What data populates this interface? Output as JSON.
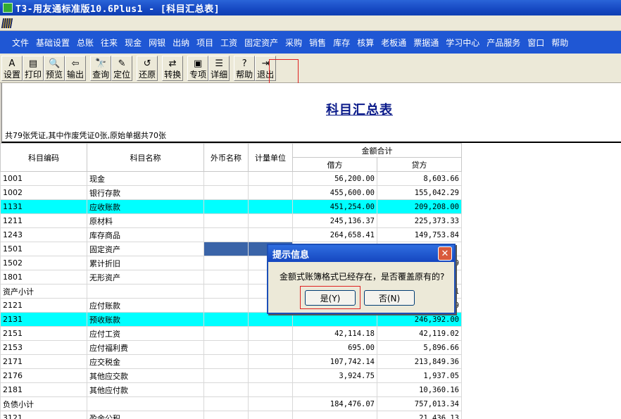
{
  "window": {
    "title": "T3-用友通标准版10.6Plus1 - [科目汇总表]"
  },
  "menu": [
    "文件",
    "基础设置",
    "总账",
    "往来",
    "现金",
    "网银",
    "出纳",
    "项目",
    "工资",
    "固定资产",
    "采购",
    "销售",
    "库存",
    "核算",
    "老板通",
    "票据通",
    "学习中心",
    "产品服务",
    "窗口",
    "帮助"
  ],
  "toolbar": {
    "groups": [
      [
        {
          "label": "设置",
          "icon": "settings-icon",
          "glyph": "A"
        },
        {
          "label": "打印",
          "icon": "print-icon",
          "glyph": "▤"
        },
        {
          "label": "预览",
          "icon": "preview-icon",
          "glyph": "🔍"
        },
        {
          "label": "输出",
          "icon": "export-icon",
          "glyph": "⇦"
        }
      ],
      [
        {
          "label": "查询",
          "icon": "query-icon",
          "glyph": "🔭"
        },
        {
          "label": "定位",
          "icon": "locate-icon",
          "glyph": "✎"
        }
      ],
      [
        {
          "label": "还原",
          "icon": "restore-icon",
          "glyph": "↺"
        }
      ],
      [
        {
          "label": "转换",
          "icon": "convert-icon",
          "glyph": "⇄"
        }
      ],
      [
        {
          "label": "专项",
          "icon": "special-icon",
          "glyph": "▣"
        },
        {
          "label": "详细",
          "icon": "detail-icon",
          "glyph": "☰"
        }
      ],
      [
        {
          "label": "帮助",
          "icon": "help-icon",
          "glyph": "?"
        },
        {
          "label": "退出",
          "icon": "exit-icon",
          "glyph": "⇥"
        }
      ]
    ]
  },
  "report": {
    "title": "科目汇总表",
    "info": "共79张凭证,其中作废凭证0张,原始单据共70张"
  },
  "table": {
    "headers": {
      "code": "科目编码",
      "name": "科目名称",
      "fc": "外币名称",
      "unit": "计量单位",
      "total": "金额合计",
      "debit": "借方",
      "credit": "贷方"
    },
    "rows": [
      {
        "code": "1001",
        "name": "现金",
        "debit": "56,200.00",
        "credit": "8,603.66",
        "hl": false
      },
      {
        "code": "1002",
        "name": "银行存款",
        "debit": "455,600.00",
        "credit": "155,042.29",
        "hl": false
      },
      {
        "code": "1131",
        "name": "应收账款",
        "debit": "451,254.00",
        "credit": "209,208.00",
        "hl": true
      },
      {
        "code": "1211",
        "name": "原材料",
        "debit": "245,136.37",
        "credit": "225,373.33",
        "hl": false
      },
      {
        "code": "1243",
        "name": "库存商品",
        "debit": "264,658.41",
        "credit": "149,753.84",
        "hl": false
      },
      {
        "code": "1501",
        "name": "固定资产",
        "debit": "",
        "credit": "",
        "hl": false,
        "sel": true
      },
      {
        "code": "1502",
        "name": "累计折旧",
        "debit": "",
        "credit": "9",
        "hl": false
      },
      {
        "code": "1801",
        "name": "无形资产",
        "debit": "",
        "credit": "",
        "hl": false
      },
      {
        "code": "资产小计",
        "name": "",
        "debit": "",
        "credit": "1",
        "hl": false
      },
      {
        "code": "2121",
        "name": "应付账款",
        "debit": "",
        "credit": "9",
        "hl": false
      },
      {
        "code": "2131",
        "name": "预收账款",
        "debit": "",
        "credit": "246,392.00",
        "hl": true
      },
      {
        "code": "2151",
        "name": "应付工资",
        "debit": "42,114.18",
        "credit": "42,119.02",
        "hl": false
      },
      {
        "code": "2153",
        "name": "应付福利费",
        "debit": "695.00",
        "credit": "5,896.66",
        "hl": false
      },
      {
        "code": "2171",
        "name": "应交税金",
        "debit": "107,742.14",
        "credit": "213,849.36",
        "hl": false
      },
      {
        "code": "2176",
        "name": "其他应交款",
        "debit": "3,924.75",
        "credit": "1,937.05",
        "hl": false
      },
      {
        "code": "2181",
        "name": "其他应付款",
        "debit": "",
        "credit": "10,360.16",
        "hl": false
      },
      {
        "code": "负债小计",
        "name": "",
        "debit": "184,476.07",
        "credit": "757,013.34",
        "hl": false
      },
      {
        "code": "3121",
        "name": "盈余公积",
        "debit": "",
        "credit": "21,436.13",
        "hl": false
      }
    ]
  },
  "dialog": {
    "title": "提示信息",
    "message": "金额式账簿格式已经存在，是否覆盖原有的?",
    "yes_label": "是(Y)",
    "no_label": "否(N)"
  },
  "colors": {
    "highlight_row": "#00ffff",
    "menubar": "#1f57d4",
    "annotation": "#e02020"
  }
}
